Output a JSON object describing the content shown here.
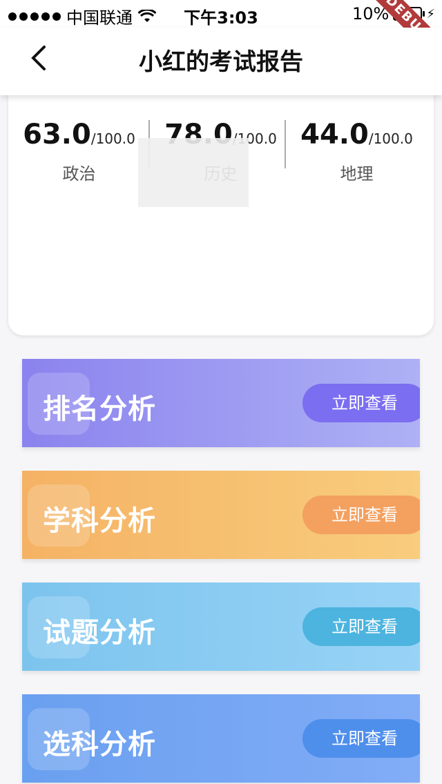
{
  "status": {
    "carrier": "中国联通",
    "time": "下午3:03",
    "battery": "10%",
    "battery_level": 0.1,
    "debug_label": "DEBUG"
  },
  "appbar": {
    "title": "小红的考试报告"
  },
  "scores": [
    {
      "score": "63.0",
      "total": "/100.0",
      "subject": "政治"
    },
    {
      "score": "78.0",
      "total": "/100.0",
      "subject": "历史"
    },
    {
      "score": "44.0",
      "total": "/100.0",
      "subject": "地理"
    }
  ],
  "analysis": [
    {
      "label": "排名分析",
      "button": "立即查看",
      "from": "#8b83ee",
      "to": "#aeb1f5",
      "btn_color": "#7b6ef0"
    },
    {
      "label": "学科分析",
      "button": "立即查看",
      "from": "#f5b264",
      "to": "#f8cd7d",
      "btn_color": "#f4a05f"
    },
    {
      "label": "试题分析",
      "button": "立即查看",
      "from": "#7cc4ee",
      "to": "#98d3f6",
      "btn_color": "#4cb4df"
    },
    {
      "label": "选科分析",
      "button": "立即查看",
      "from": "#6aa0f0",
      "to": "#82acf6",
      "btn_color": "#4f8fec"
    }
  ]
}
